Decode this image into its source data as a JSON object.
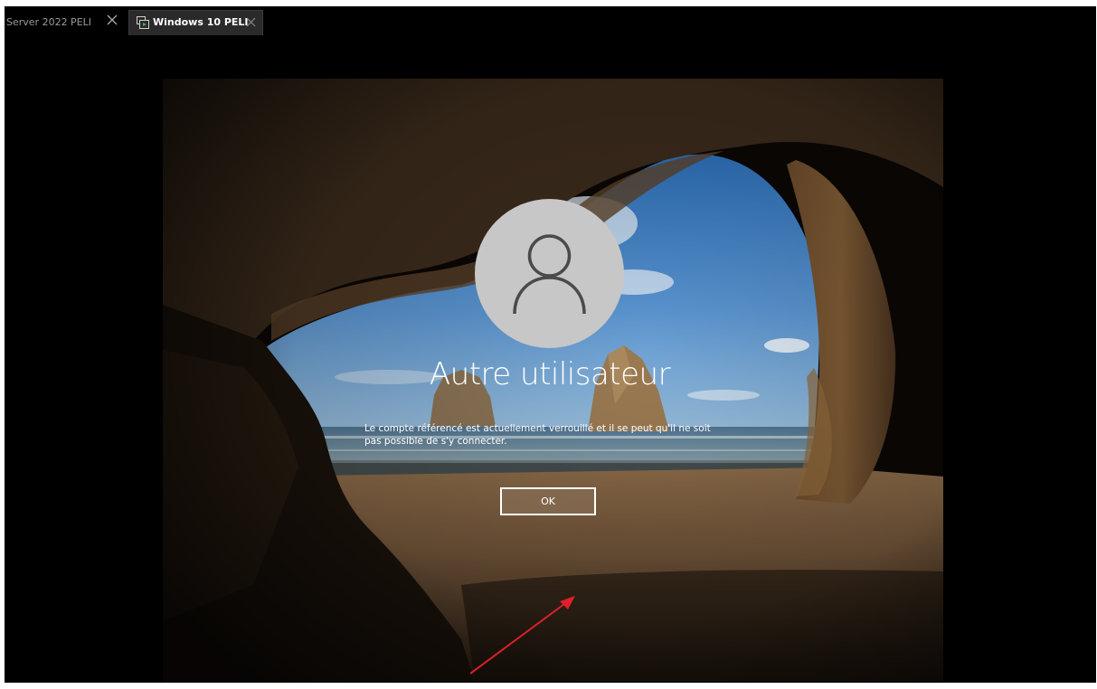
{
  "tabs": [
    {
      "label": "Server 2022 PELI",
      "active": false
    },
    {
      "label": "Windows 10 PELI",
      "active": true
    }
  ],
  "lockscreen": {
    "username": "Autre utilisateur",
    "message_line1": "Le compte référencé est actuellement verrouillé et il se peut qu'il ne soit",
    "message_line2": "pas possible de s'y connecter.",
    "ok_label": "OK"
  },
  "colors": {
    "frame_background": "#000000",
    "active_tab_background": "#2a2a2a",
    "avatar_background": "#c7c7c7",
    "annotation_arrow": "#e0202a"
  },
  "icons": {
    "user_avatar": "user-silhouette-icon",
    "vm_tab": "vm-console-icon",
    "close": "close-icon"
  }
}
